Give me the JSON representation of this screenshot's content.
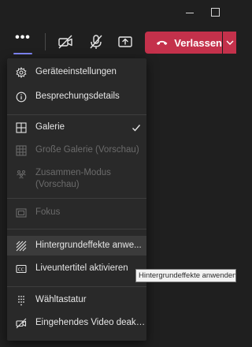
{
  "window": {
    "minimize_icon": "minimize-icon",
    "maximize_icon": "maximize-icon"
  },
  "toolbar": {
    "more_label": "•••",
    "camera_icon": "camera-off-icon",
    "mic_icon": "mic-off-icon",
    "share_icon": "share-screen-icon",
    "leave_label": "Verlassen",
    "accent_color": "#7f85f5",
    "leave_color": "#c4314b"
  },
  "menu": {
    "items": [
      {
        "label": "Geräteeinstellungen",
        "icon": "gear-icon",
        "enabled": true
      },
      {
        "label": "Besprechungsdetails",
        "icon": "info-icon",
        "enabled": true
      },
      {
        "label": "Galerie",
        "icon": "gallery-icon",
        "enabled": true,
        "checked": true
      },
      {
        "label": "Große Galerie (Vorschau)",
        "icon": "large-gallery-icon",
        "enabled": false
      },
      {
        "label": "Zusammen-Modus (Vorschau)",
        "icon": "together-mode-icon",
        "enabled": false
      },
      {
        "label": "Fokus",
        "icon": "focus-icon",
        "enabled": false
      },
      {
        "label": "Hintergrundeffekte anwe...",
        "icon": "background-effects-icon",
        "enabled": true,
        "hovered": true
      },
      {
        "label": "Liveuntertitel aktivieren",
        "icon": "captions-icon",
        "enabled": true
      },
      {
        "label": "Wähltastatur",
        "icon": "dialpad-icon",
        "enabled": true
      },
      {
        "label": "Eingehendes Video deakt...",
        "icon": "video-off-icon",
        "enabled": true
      }
    ]
  },
  "tooltip": {
    "text": "Hintergrundeffekte anwenden"
  }
}
